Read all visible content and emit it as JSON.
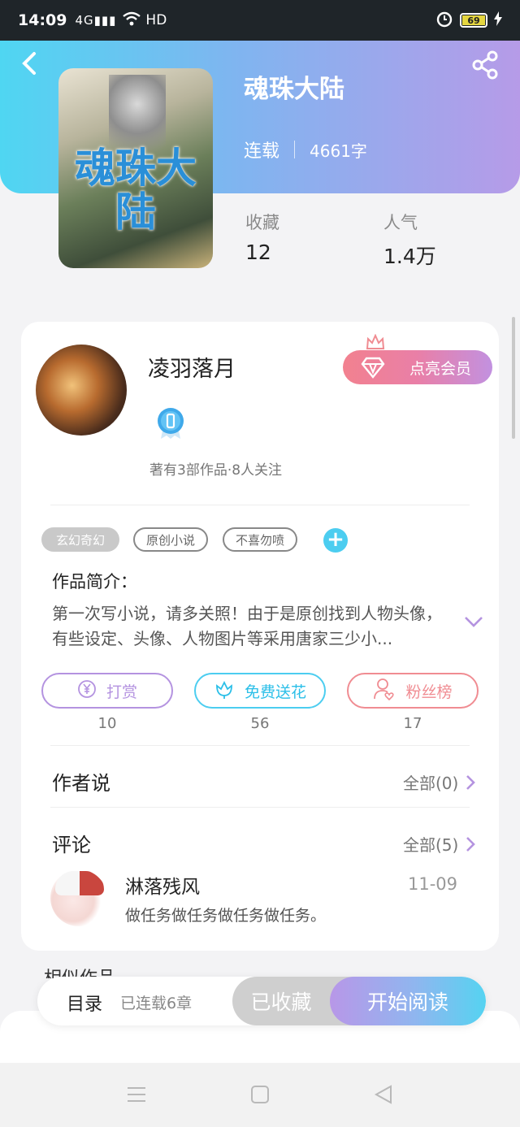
{
  "status_bar": {
    "time": "14:09",
    "signal": "4G",
    "network": "HD",
    "battery": "69"
  },
  "book": {
    "title": "魂珠大陆",
    "cover_text": "魂珠大陆",
    "status": "连载",
    "words": "4661字",
    "stats": [
      {
        "label": "收藏",
        "value": "12"
      },
      {
        "label": "人气",
        "value": "1.4万"
      }
    ]
  },
  "author": {
    "name": "凌羽落月",
    "vip_button": "点亮会员",
    "summary": "著有3部作品·8人关注"
  },
  "tags": [
    "玄幻奇幻",
    "原创小说",
    "不喜勿喷"
  ],
  "intro": {
    "title": "作品简介：",
    "text": "第一次写小说，请多关照！由于是原创找到人物头像，有些设定、头像、人物图片等采用唐家三少小..."
  },
  "actions": [
    {
      "label": "打赏",
      "count": "10",
      "color": "#b493e0"
    },
    {
      "label": "免费送花",
      "count": "56",
      "color": "#4ccdf0"
    },
    {
      "label": "粉丝榜",
      "count": "17",
      "color": "#f08c92"
    }
  ],
  "author_says": {
    "title": "作者说",
    "more": "全部(0)"
  },
  "comments": {
    "title": "评论",
    "more": "全部(5)",
    "items": [
      {
        "user": "淋落残风",
        "date": "11-09",
        "text": "做任务做任务做任务做任务。"
      }
    ]
  },
  "similar": {
    "title": "相似作品"
  },
  "bottom_bar": {
    "toc": "目录",
    "toc_count": "已连载6章",
    "collected": "已收藏",
    "read": "开始阅读"
  },
  "icons": {
    "back": "back-arrow-icon",
    "share": "share-icon",
    "crown": "crown-icon",
    "diamond": "diamond-icon",
    "badge": "badge-icon",
    "add": "plus-icon",
    "expand": "chevron-down-icon",
    "reward": "yen-icon",
    "flower": "flower-icon",
    "fans": "user-heart-icon"
  },
  "colors": {
    "accent_cyan": "#4ccdf0",
    "accent_purple": "#b493e0",
    "accent_pink": "#f08c92"
  }
}
